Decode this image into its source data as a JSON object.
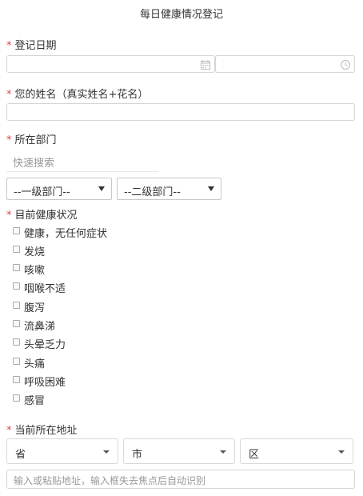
{
  "form": {
    "title": "每日健康情况登记",
    "required_mark": "*"
  },
  "date_field": {
    "label": "登记日期",
    "date_value": "",
    "time_value": "",
    "date_icon": "calendar-icon",
    "time_icon": "clock-icon"
  },
  "name_field": {
    "label": "您的姓名（真实姓名+花名）",
    "value": ""
  },
  "department": {
    "label": "所在部门",
    "search_placeholder": "快速搜索",
    "level1": "--一级部门--",
    "level2": "--二级部门--"
  },
  "health": {
    "label": "目前健康状况",
    "options": [
      "健康，无任何症状",
      "发烧",
      "咳嗽",
      "咽喉不适",
      "腹泻",
      "流鼻涕",
      "头晕乏力",
      "头痛",
      "呼吸困难",
      "感冒"
    ]
  },
  "address": {
    "label": "当前所在地址",
    "province": "省",
    "city": "市",
    "district": "区",
    "detail_placeholder": "输入或粘贴地址，输入框失去焦点后自动识别"
  },
  "colors": {
    "required": "#e8403d",
    "border": "#d4d4d4",
    "text": "#333333",
    "placeholder": "#999999"
  }
}
